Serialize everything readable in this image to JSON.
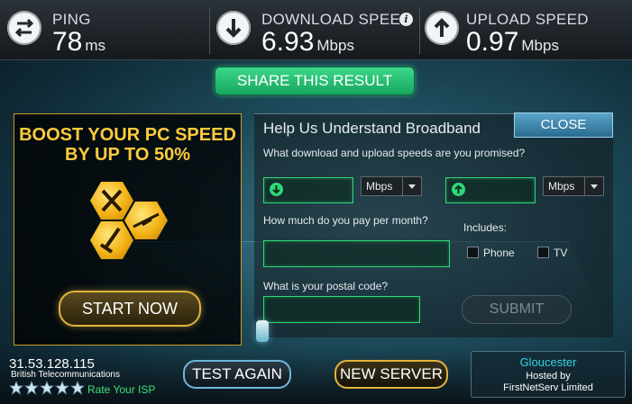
{
  "metrics": {
    "ping": {
      "label": "PING",
      "value": "78",
      "unit": "ms",
      "icon": "swap-arrows-icon"
    },
    "download": {
      "label": "DOWNLOAD SPEED",
      "value": "6.93",
      "unit": "Mbps",
      "icon": "download-arrow-icon"
    },
    "upload": {
      "label": "UPLOAD SPEED",
      "value": "0.97",
      "unit": "Mbps",
      "icon": "upload-arrow-icon"
    }
  },
  "share_label": "SHARE THIS RESULT",
  "promo": {
    "line1": "BOOST YOUR PC SPEED",
    "line2": "BY UP TO 50%",
    "button": "START NOW"
  },
  "survey": {
    "title": "Help Us Understand Broadband",
    "close": "CLOSE",
    "q_speeds": "What download and upload speeds are you promised?",
    "download_unit": "Mbps",
    "upload_unit": "Mbps",
    "q_pay": "How much do you pay per month?",
    "includes": "Includes:",
    "phone": "Phone",
    "tv": "TV",
    "q_postal": "What is your postal code?",
    "submit": "SUBMIT"
  },
  "footer": {
    "ip": "31.53.128.115",
    "isp": "British Telecommunications",
    "rate": "Rate Your ISP",
    "test_again": "TEST AGAIN",
    "new_server": "NEW SERVER",
    "city": "Gloucester",
    "hosted_by": "Hosted by",
    "host": "FirstNetServ Limited"
  },
  "colors": {
    "accent_green": "#2fd87a",
    "gold": "#ffcb3d",
    "cyan": "#34d3e8"
  }
}
